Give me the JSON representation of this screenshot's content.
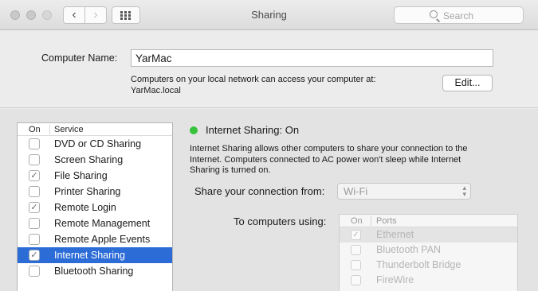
{
  "window": {
    "title": "Sharing"
  },
  "toolbar": {
    "back_glyph": "‹",
    "forward_glyph": "›",
    "search_placeholder": "Search"
  },
  "computer": {
    "label": "Computer Name:",
    "value": "YarMac",
    "description_line1": "Computers on your local network can access your computer at:",
    "description_line2": "YarMac.local",
    "edit_label": "Edit..."
  },
  "services": {
    "header_on": "On",
    "header_service": "Service",
    "items": [
      {
        "name": "DVD or CD Sharing",
        "checked": false
      },
      {
        "name": "Screen Sharing",
        "checked": false
      },
      {
        "name": "File Sharing",
        "checked": true
      },
      {
        "name": "Printer Sharing",
        "checked": false
      },
      {
        "name": "Remote Login",
        "checked": true
      },
      {
        "name": "Remote Management",
        "checked": false
      },
      {
        "name": "Remote Apple Events",
        "checked": false
      },
      {
        "name": "Internet Sharing",
        "checked": true,
        "selected": true
      },
      {
        "name": "Bluetooth Sharing",
        "checked": false
      }
    ]
  },
  "detail": {
    "status": "Internet Sharing: On",
    "status_color": "#36c33b",
    "info_line1": "Internet Sharing allows other computers to share your connection to the",
    "info_line2": "Internet. Computers connected to AC power won't sleep while Internet",
    "info_line3": "Sharing is turned on.",
    "share_from_label": "Share your connection from:",
    "share_from_value": "Wi-Fi",
    "to_computers_label": "To computers using:",
    "ports_header_on": "On",
    "ports_header_ports": "Ports",
    "ports": [
      {
        "name": "Ethernet",
        "checked": true
      },
      {
        "name": "Bluetooth PAN",
        "checked": false
      },
      {
        "name": "Thunderbolt Bridge",
        "checked": false
      },
      {
        "name": "FireWire",
        "checked": false
      }
    ]
  },
  "colors": {
    "selection": "#2c6cd6",
    "status_green": "#36c33b"
  },
  "check_glyph": "✓"
}
